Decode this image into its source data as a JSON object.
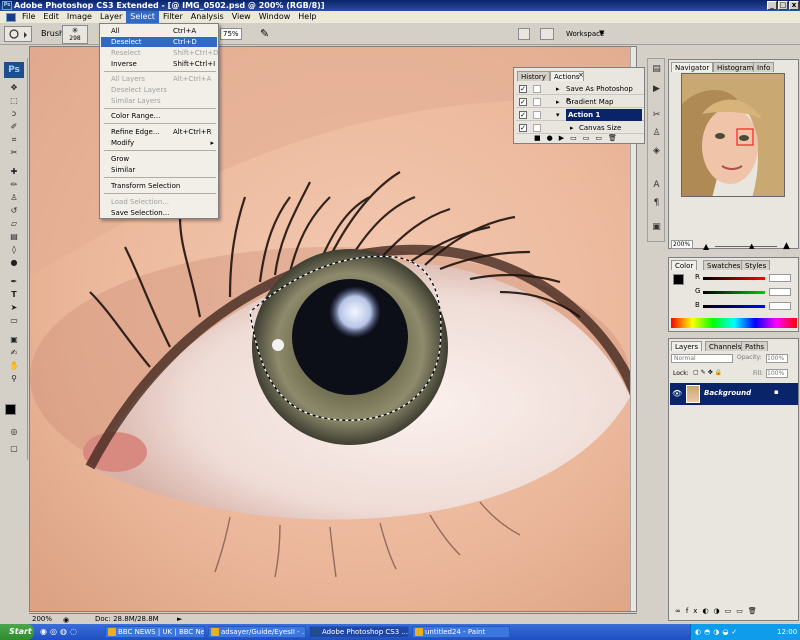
{
  "window": {
    "title": "Adobe Photoshop CS3 Extended - [@ IMG_0502.psd @ 200% (RGB/8)]",
    "app_badge": "Ps"
  },
  "menubar": [
    "File",
    "Edit",
    "Image",
    "Layer",
    "Select",
    "Filter",
    "Analysis",
    "View",
    "Window",
    "Help"
  ],
  "options": {
    "brush_label": "Brush:",
    "brush_size": "298",
    "zoom_value": "75%",
    "workspace_label": "Workspace"
  },
  "select_menu": {
    "items": [
      {
        "label": "All",
        "shortcut": "Ctrl+A",
        "state": "normal"
      },
      {
        "label": "Deselect",
        "shortcut": "Ctrl+D",
        "state": "highlighted"
      },
      {
        "label": "Reselect",
        "shortcut": "Shift+Ctrl+D",
        "state": "disabled"
      },
      {
        "label": "Inverse",
        "shortcut": "Shift+Ctrl+I",
        "state": "normal"
      },
      {
        "label": "All Layers",
        "shortcut": "Alt+Ctrl+A",
        "state": "disabled"
      },
      {
        "label": "Deselect Layers",
        "shortcut": "",
        "state": "disabled"
      },
      {
        "label": "Similar Layers",
        "shortcut": "",
        "state": "disabled"
      },
      {
        "label": "Color Range...",
        "shortcut": "",
        "state": "normal"
      },
      {
        "label": "Refine Edge...",
        "shortcut": "Alt+Ctrl+R",
        "state": "normal"
      },
      {
        "label": "Modify",
        "shortcut": "",
        "state": "submenu"
      },
      {
        "label": "Grow",
        "shortcut": "",
        "state": "normal"
      },
      {
        "label": "Similar",
        "shortcut": "",
        "state": "normal"
      },
      {
        "label": "Transform Selection",
        "shortcut": "",
        "state": "normal"
      },
      {
        "label": "Load Selection...",
        "shortcut": "",
        "state": "disabled"
      },
      {
        "label": "Save Selection...",
        "shortcut": "",
        "state": "normal"
      }
    ]
  },
  "actions_panel": {
    "tabs": [
      "History",
      "Actions"
    ],
    "rows": [
      "Save As Photoshop P...",
      "Gradient Map",
      "Action 1",
      "Canvas Size"
    ]
  },
  "navigator_panel": {
    "tabs": [
      "Navigator",
      "Histogram",
      "Info"
    ],
    "zoom": "200%"
  },
  "color_panel": {
    "tabs": [
      "Color",
      "Swatches",
      "Styles"
    ],
    "channels": [
      "R",
      "G",
      "B"
    ]
  },
  "layers_panel": {
    "tabs": [
      "Layers",
      "Channels",
      "Paths"
    ],
    "blend_mode": "Normal",
    "opacity_label": "Opacity:",
    "opacity_value": "100%",
    "lock_label": "Lock:",
    "fill_label": "Fill:",
    "fill_value": "100%",
    "layer_name": "Background"
  },
  "statusbar": {
    "zoom": "200%",
    "doc": "Doc: 28.8M/28.8M"
  },
  "taskbar": {
    "start": "Start",
    "tasks": [
      {
        "label": "BBC NEWS | UK | BBC Ne...",
        "active": false
      },
      {
        "label": "adsayer/Guide/EyesII - ...",
        "active": false
      },
      {
        "label": "Adobe Photoshop CS3 ...",
        "active": true
      },
      {
        "label": "untitled24 - Paint",
        "active": false
      }
    ],
    "clock": "12:00"
  },
  "colors": {
    "highlight": "#316ac5",
    "titlebar": "#0a246a",
    "taskbar": "#245edb",
    "selected_layer": "#0a246a"
  }
}
